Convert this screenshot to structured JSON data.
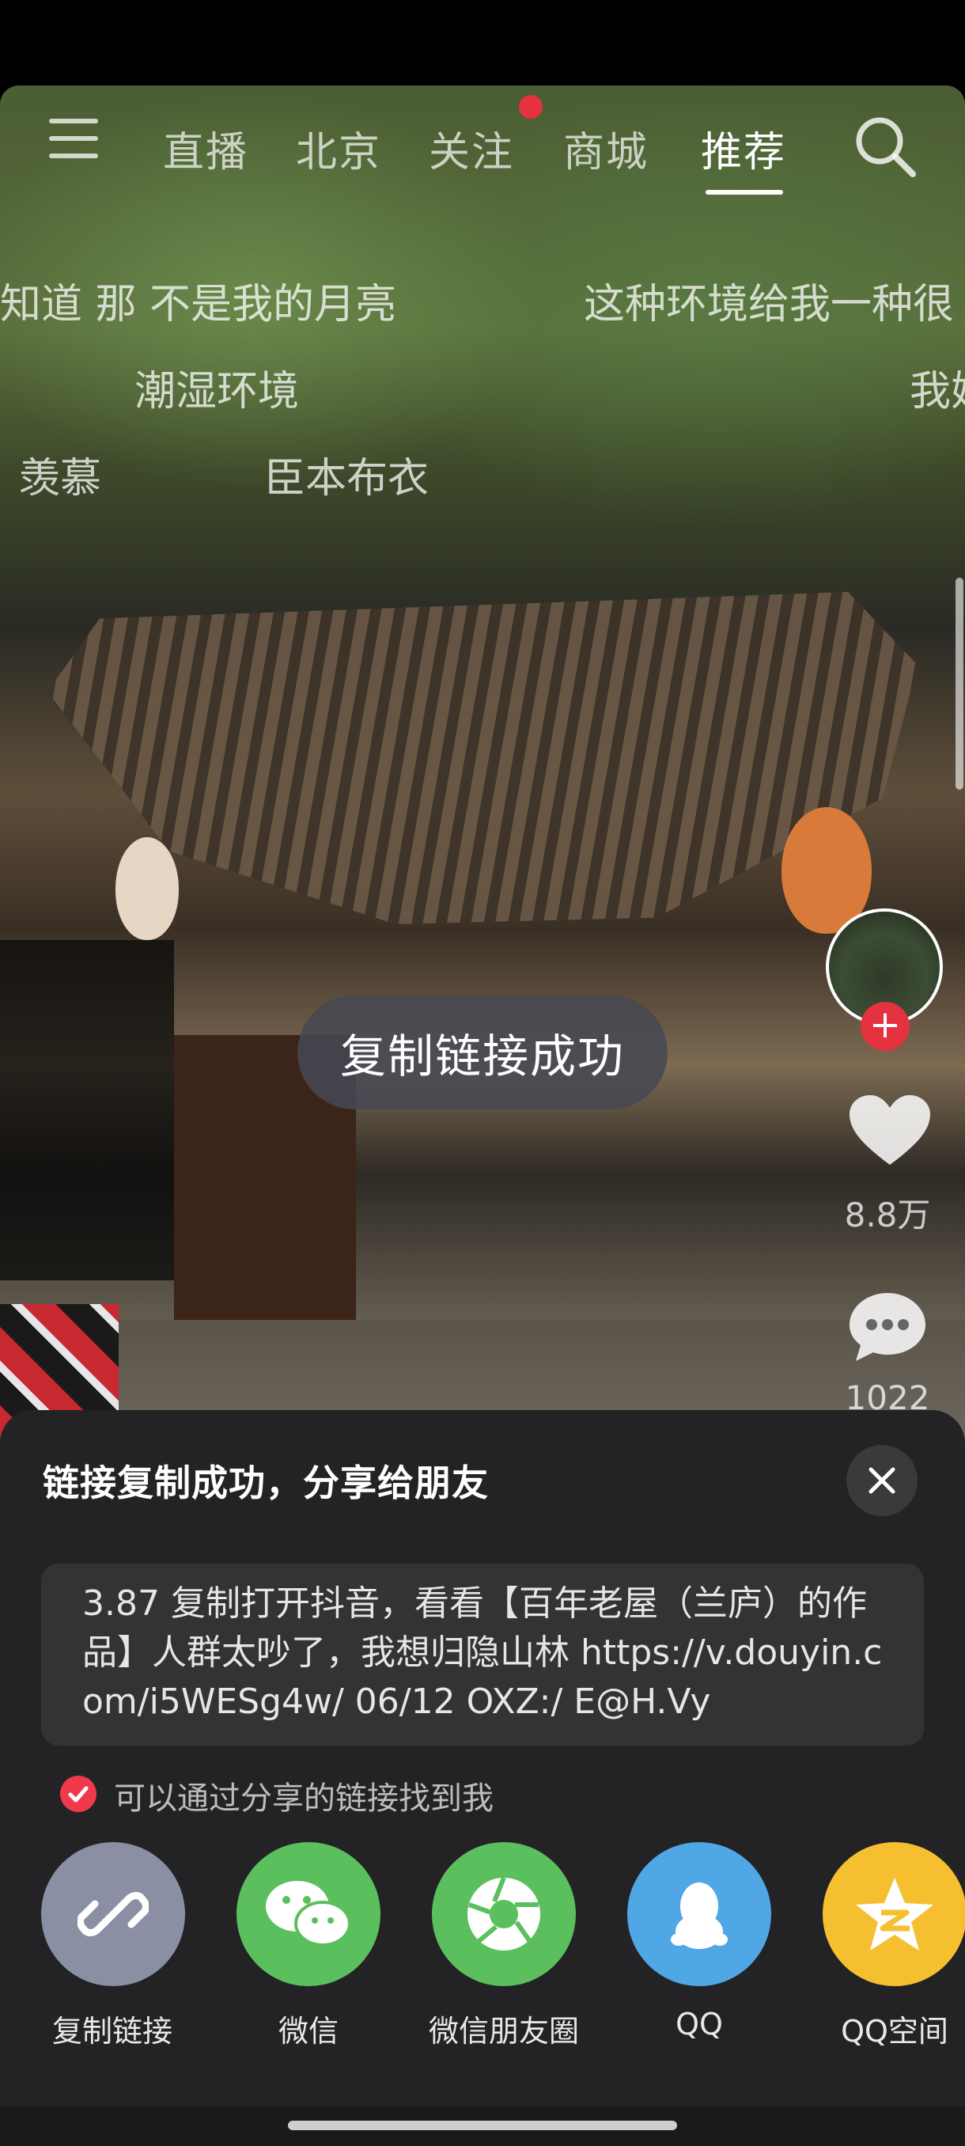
{
  "top_nav": {
    "tabs": [
      {
        "label": "直播"
      },
      {
        "label": "北京"
      },
      {
        "label": "关注"
      },
      {
        "label": "商城"
      },
      {
        "label": "推荐"
      }
    ],
    "active_tab": "推荐"
  },
  "danmaku": [
    "知道 那 不是我的月亮",
    "这种环境给我一种很",
    "潮湿环境",
    "我妈",
    "羡慕",
    "臣本布衣"
  ],
  "toast": {
    "text": "复制链接成功"
  },
  "sidebar": {
    "likes": "8.8万",
    "comments": "1022"
  },
  "share_sheet": {
    "title": "链接复制成功，分享给朋友",
    "link_text": "3.87 复制打开抖音，看看【百年老屋（兰庐）的作品】人群太吵了，我想归隐山林  https://v.douyin.com/i5WESg4w/ 06/12 OXZ:/ E@H.Vy",
    "findable_label": "可以通过分享的链接找到我",
    "targets": [
      {
        "label": "复制链接",
        "color": "#8a8fa3"
      },
      {
        "label": "微信",
        "color": "#5cbf5e"
      },
      {
        "label": "微信朋友圈",
        "color": "#5cbf5e"
      },
      {
        "label": "QQ",
        "color": "#4fa7e6"
      },
      {
        "label": "QQ空间",
        "color": "#f5bf2f"
      }
    ]
  }
}
